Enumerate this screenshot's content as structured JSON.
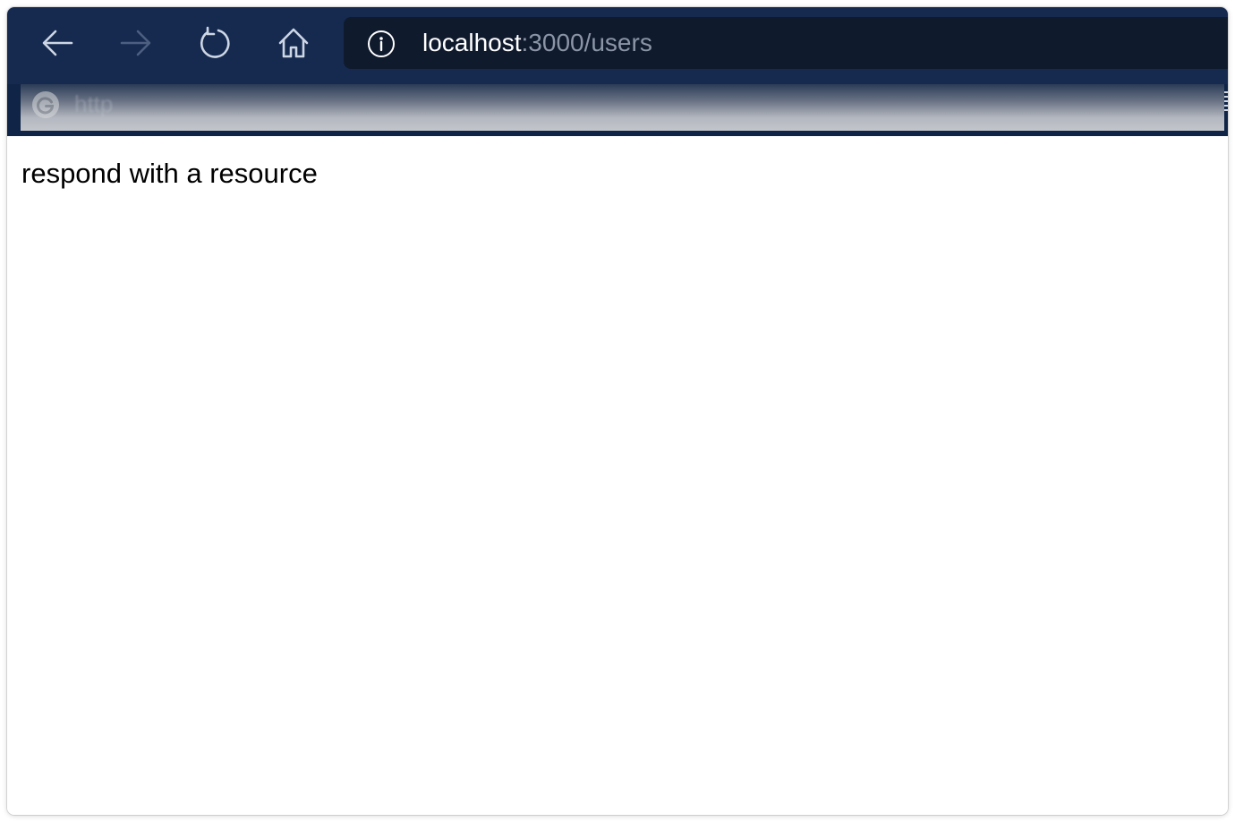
{
  "browser": {
    "url": {
      "host": "localhost",
      "rest": ":3000/users"
    },
    "bookmarks_bar": {
      "text": "http"
    },
    "icons": {
      "back": "arrow-left-icon",
      "forward": "arrow-right-icon",
      "reload": "reload-icon",
      "home": "home-icon",
      "site_info": "info-icon",
      "bookmark": "google-icon"
    },
    "colors": {
      "toolbar": "#162a50",
      "urlbar": "#0f1a2d",
      "bookmarks_bar": "#0f2447",
      "url_host": "#ffffff",
      "url_path": "#8b95a6"
    }
  },
  "page": {
    "text": "respond with a resource"
  }
}
